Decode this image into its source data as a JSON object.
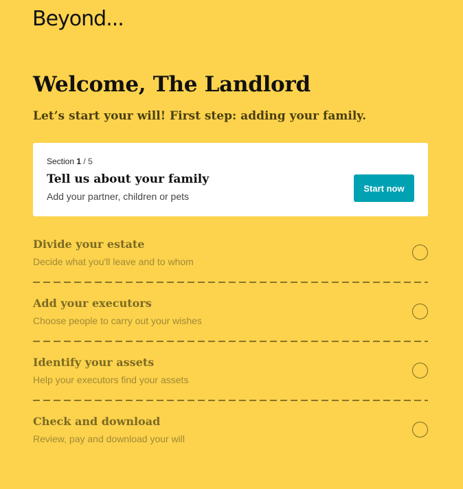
{
  "brand": {
    "logo_text": "Beyond..."
  },
  "header": {
    "title": "Welcome, The Landlord",
    "subtitle": "Let’s start your will! First step: adding your family."
  },
  "current_section": {
    "section_label": "Section",
    "section_number": "1",
    "section_total": "/ 5",
    "title": "Tell us about your family",
    "description": "Add your partner, children or pets",
    "button_label": "Start now"
  },
  "steps": [
    {
      "title": "Divide your estate",
      "description": "Decide what you'll leave and to whom",
      "completed": false
    },
    {
      "title": "Add your executors",
      "description": "Choose people to carry out your wishes",
      "completed": false
    },
    {
      "title": "Identify your assets",
      "description": "Help your executors find your assets",
      "completed": false
    },
    {
      "title": "Check and download",
      "description": "Review, pay and download your will",
      "completed": false
    }
  ],
  "colors": {
    "background": "#fdd34d",
    "accent_button": "#00a1b3",
    "step_text": "#7c6a22"
  }
}
